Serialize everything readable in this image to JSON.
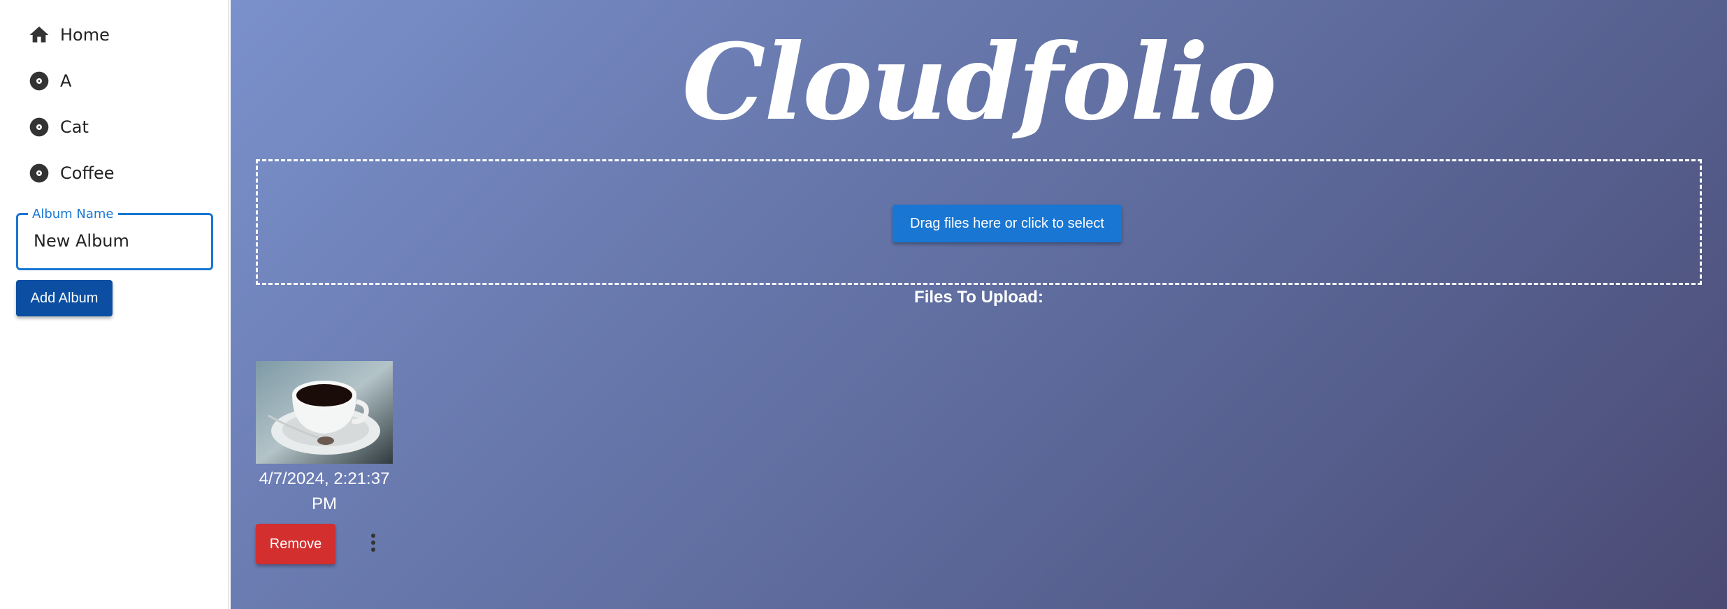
{
  "sidebar": {
    "items": [
      {
        "label": "Home",
        "icon": "home-icon"
      },
      {
        "label": "A",
        "icon": "album-icon"
      },
      {
        "label": "Cat",
        "icon": "album-icon"
      },
      {
        "label": "Coffee",
        "icon": "album-icon"
      }
    ],
    "album_field": {
      "legend": "Album Name",
      "value": "New Album"
    },
    "add_album_label": "Add Album"
  },
  "main": {
    "brand": "Cloudfolio",
    "dropzone_label": "Drag files here or click to select",
    "files_title": "Files To Upload:",
    "files": [
      {
        "date": "4/7/2024, 2:21:37 PM",
        "remove_label": "Remove",
        "thumbnail": "coffee-cup-image"
      }
    ]
  },
  "colors": {
    "primary": "#1976d2",
    "add_button": "#0b4ea2",
    "remove_button": "#d32f2f",
    "gradient_start": "#7b91cc",
    "gradient_end": "#4a4a73"
  }
}
